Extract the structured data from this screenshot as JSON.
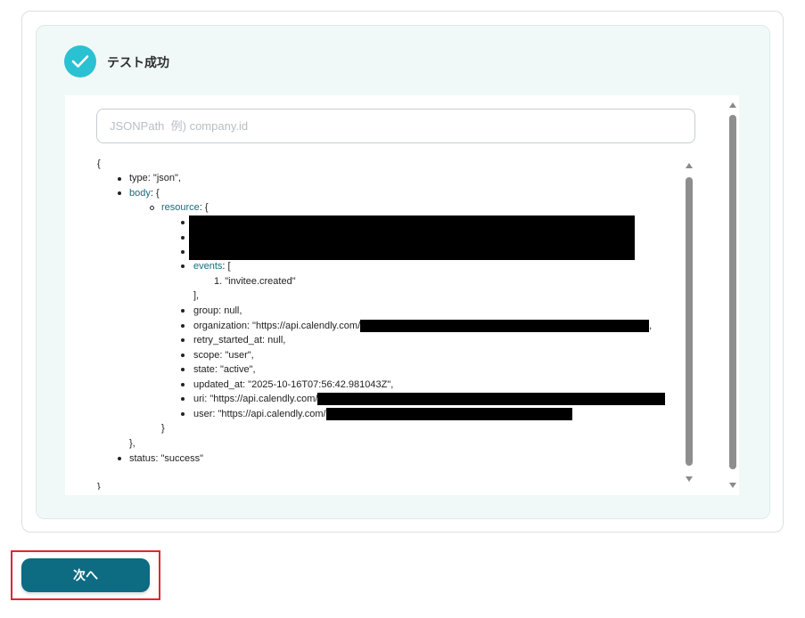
{
  "result": {
    "title": "テスト成功",
    "status_icon": "check-icon"
  },
  "jsonpath": {
    "placeholder": "JSONPath  例) company.id",
    "value": ""
  },
  "json_tree": {
    "open_brace": "{",
    "close_brace": "}",
    "type_key": "type",
    "type_value": ": \"json\",",
    "body_key": "body",
    "body_open": ": {",
    "resource_key": "resource",
    "resource_open": ": {",
    "events_key": "events",
    "events_open": ": [",
    "events_item_number": "1.",
    "events_item_value": "\"invitee.created\"",
    "events_close": "],",
    "group": "group: null,",
    "organization_prefix": "organization: \"https://api.calendly.com/",
    "organization_suffix": ",",
    "retry_started_at": "retry_started_at: null,",
    "scope": "scope: \"user\",",
    "state": "state: \"active\",",
    "updated_at": "updated_at: \"2025-10-16T07:56:42.981043Z\",",
    "uri_prefix": "uri: \"https://api.calendly.com/",
    "user_prefix": "user: \"https://api.calendly.com/",
    "resource_close": "}",
    "body_close": "},",
    "status": "status: \"success\""
  },
  "actions": {
    "next_label": "次へ"
  },
  "colors": {
    "accent_teal": "#0d6b82",
    "success_icon": "#2ac1d3",
    "panel_bg": "#f1f9f8",
    "key_color": "#1a6a7c",
    "highlight": "#e4262a"
  }
}
